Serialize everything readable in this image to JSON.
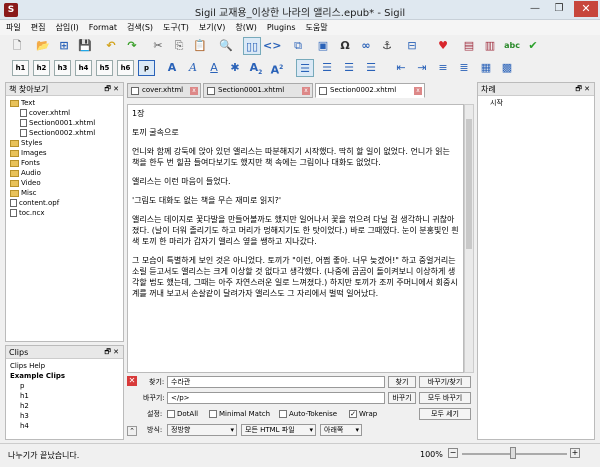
{
  "window": {
    "title": "Sigil 교재용_이상한 나라의 앨리스.epub* - Sigil",
    "app_icon": "S"
  },
  "menu": [
    "파일",
    "편집",
    "삽입(I)",
    "Format",
    "검색(S)",
    "도구(T)",
    "보기(V)",
    "창(W)",
    "Plugins",
    "도움말"
  ],
  "heading_buttons": [
    "h1",
    "h2",
    "h3",
    "h4",
    "h5",
    "h6",
    "p"
  ],
  "book_browser": {
    "title": "책 찾아보기",
    "items": [
      {
        "label": "Text",
        "type": "folder",
        "indent": 0
      },
      {
        "label": "cover.xhtml",
        "type": "file",
        "indent": 1
      },
      {
        "label": "Section0001.xhtml",
        "type": "file",
        "indent": 1
      },
      {
        "label": "Section0002.xhtml",
        "type": "file",
        "indent": 1
      },
      {
        "label": "Styles",
        "type": "folder",
        "indent": 0
      },
      {
        "label": "Images",
        "type": "folder",
        "indent": 0
      },
      {
        "label": "Fonts",
        "type": "folder",
        "indent": 0
      },
      {
        "label": "Audio",
        "type": "folder",
        "indent": 0
      },
      {
        "label": "Video",
        "type": "folder",
        "indent": 0
      },
      {
        "label": "Misc",
        "type": "folder",
        "indent": 0
      },
      {
        "label": "content.opf",
        "type": "file",
        "indent": 0
      },
      {
        "label": "toc.ncx",
        "type": "file",
        "indent": 0
      }
    ]
  },
  "clips": {
    "title": "Clips",
    "items": [
      {
        "label": "Clips Help",
        "bold": false,
        "indent": 0
      },
      {
        "label": "Example Clips",
        "bold": true,
        "indent": 0
      },
      {
        "label": "p",
        "bold": false,
        "indent": 1
      },
      {
        "label": "h1",
        "bold": false,
        "indent": 1
      },
      {
        "label": "h2",
        "bold": false,
        "indent": 1
      },
      {
        "label": "h3",
        "bold": false,
        "indent": 1
      },
      {
        "label": "h4",
        "bold": false,
        "indent": 1
      }
    ]
  },
  "tabs": [
    {
      "label": "cover.xhtml",
      "active": false
    },
    {
      "label": "Section0001.xhtml",
      "active": false
    },
    {
      "label": "Section0002.xhtml",
      "active": true
    }
  ],
  "editor": {
    "paragraphs": [
      "1장",
      "토끼 굴속으로",
      "언니와 함께 강둑에 앉아 있던 앨리스는 따분해지기 시작했다. 딱히 할 일이 없었다. 언니가 읽는 책을 한두 번 힐끔 들여다보기도 했지만 책 속에는 그림이나 대화도 없었다.",
      "앨리스는 이런 마음이 들었다.",
      "'그림도 대화도 없는 책을 무슨 재미로 읽지?'",
      "앨리스는 데이지로 꽃다발을 만들어볼까도 했지만 일어나서 꽃을 꺾으려 다닐 걸 생각하니 귀찮아졌다. (날이 더워 졸리기도 하고 머리가 멍해지기도 한 탓이었다.) 바로 그때였다. 눈이 분홍빛인 흰색 토끼 한 마리가 갑자기 앨리스 옆을 쌩하고 지나갔다.",
      "그 모습이 특별하게 보인 것은 아니었다. 토끼가 \"이런, 어쩜 좋아. 너무 늦겠어!\" 하고 중얼거리는 소릴 듣고서도 앨리스는 크게 이상할 것 없다고 생각했다. (나중에 곰곰이 돌이켜보니 이상하게 생각할 법도 했는데, 그때는 아주 자연스러운 일로 느껴졌다.) 하지만 토끼가 조끼 주머니에서 회중시계를 꺼내 보고서 손살같이 달려가자 앨리스도 그 자리에서 벌떡 일어났다."
    ]
  },
  "find_replace": {
    "find_label": "찾기:",
    "find_value": "수라관",
    "replace_label": "바꾸기:",
    "replace_value": "</p>",
    "options_label": "설정:",
    "options": [
      {
        "label": "DotAll",
        "checked": false
      },
      {
        "label": "Minimal Match",
        "checked": false
      },
      {
        "label": "Auto-Tokenise",
        "checked": false
      },
      {
        "label": "Wrap",
        "checked": true
      }
    ],
    "mode_label": "방식:",
    "mode_value": "정방향",
    "scope_value": "모든 HTML 파일",
    "direction_value": "아래쪽",
    "buttons": {
      "find": "찾기",
      "replace_find": "바꾸기/찾기",
      "replace": "바꾸기",
      "replace_all": "모두 바꾸기",
      "count_all": "모두 세기"
    }
  },
  "toc": {
    "title": "차례",
    "items": [
      "시작"
    ]
  },
  "status": {
    "message": "나누기가 끝났습니다.",
    "zoom": "100%"
  }
}
